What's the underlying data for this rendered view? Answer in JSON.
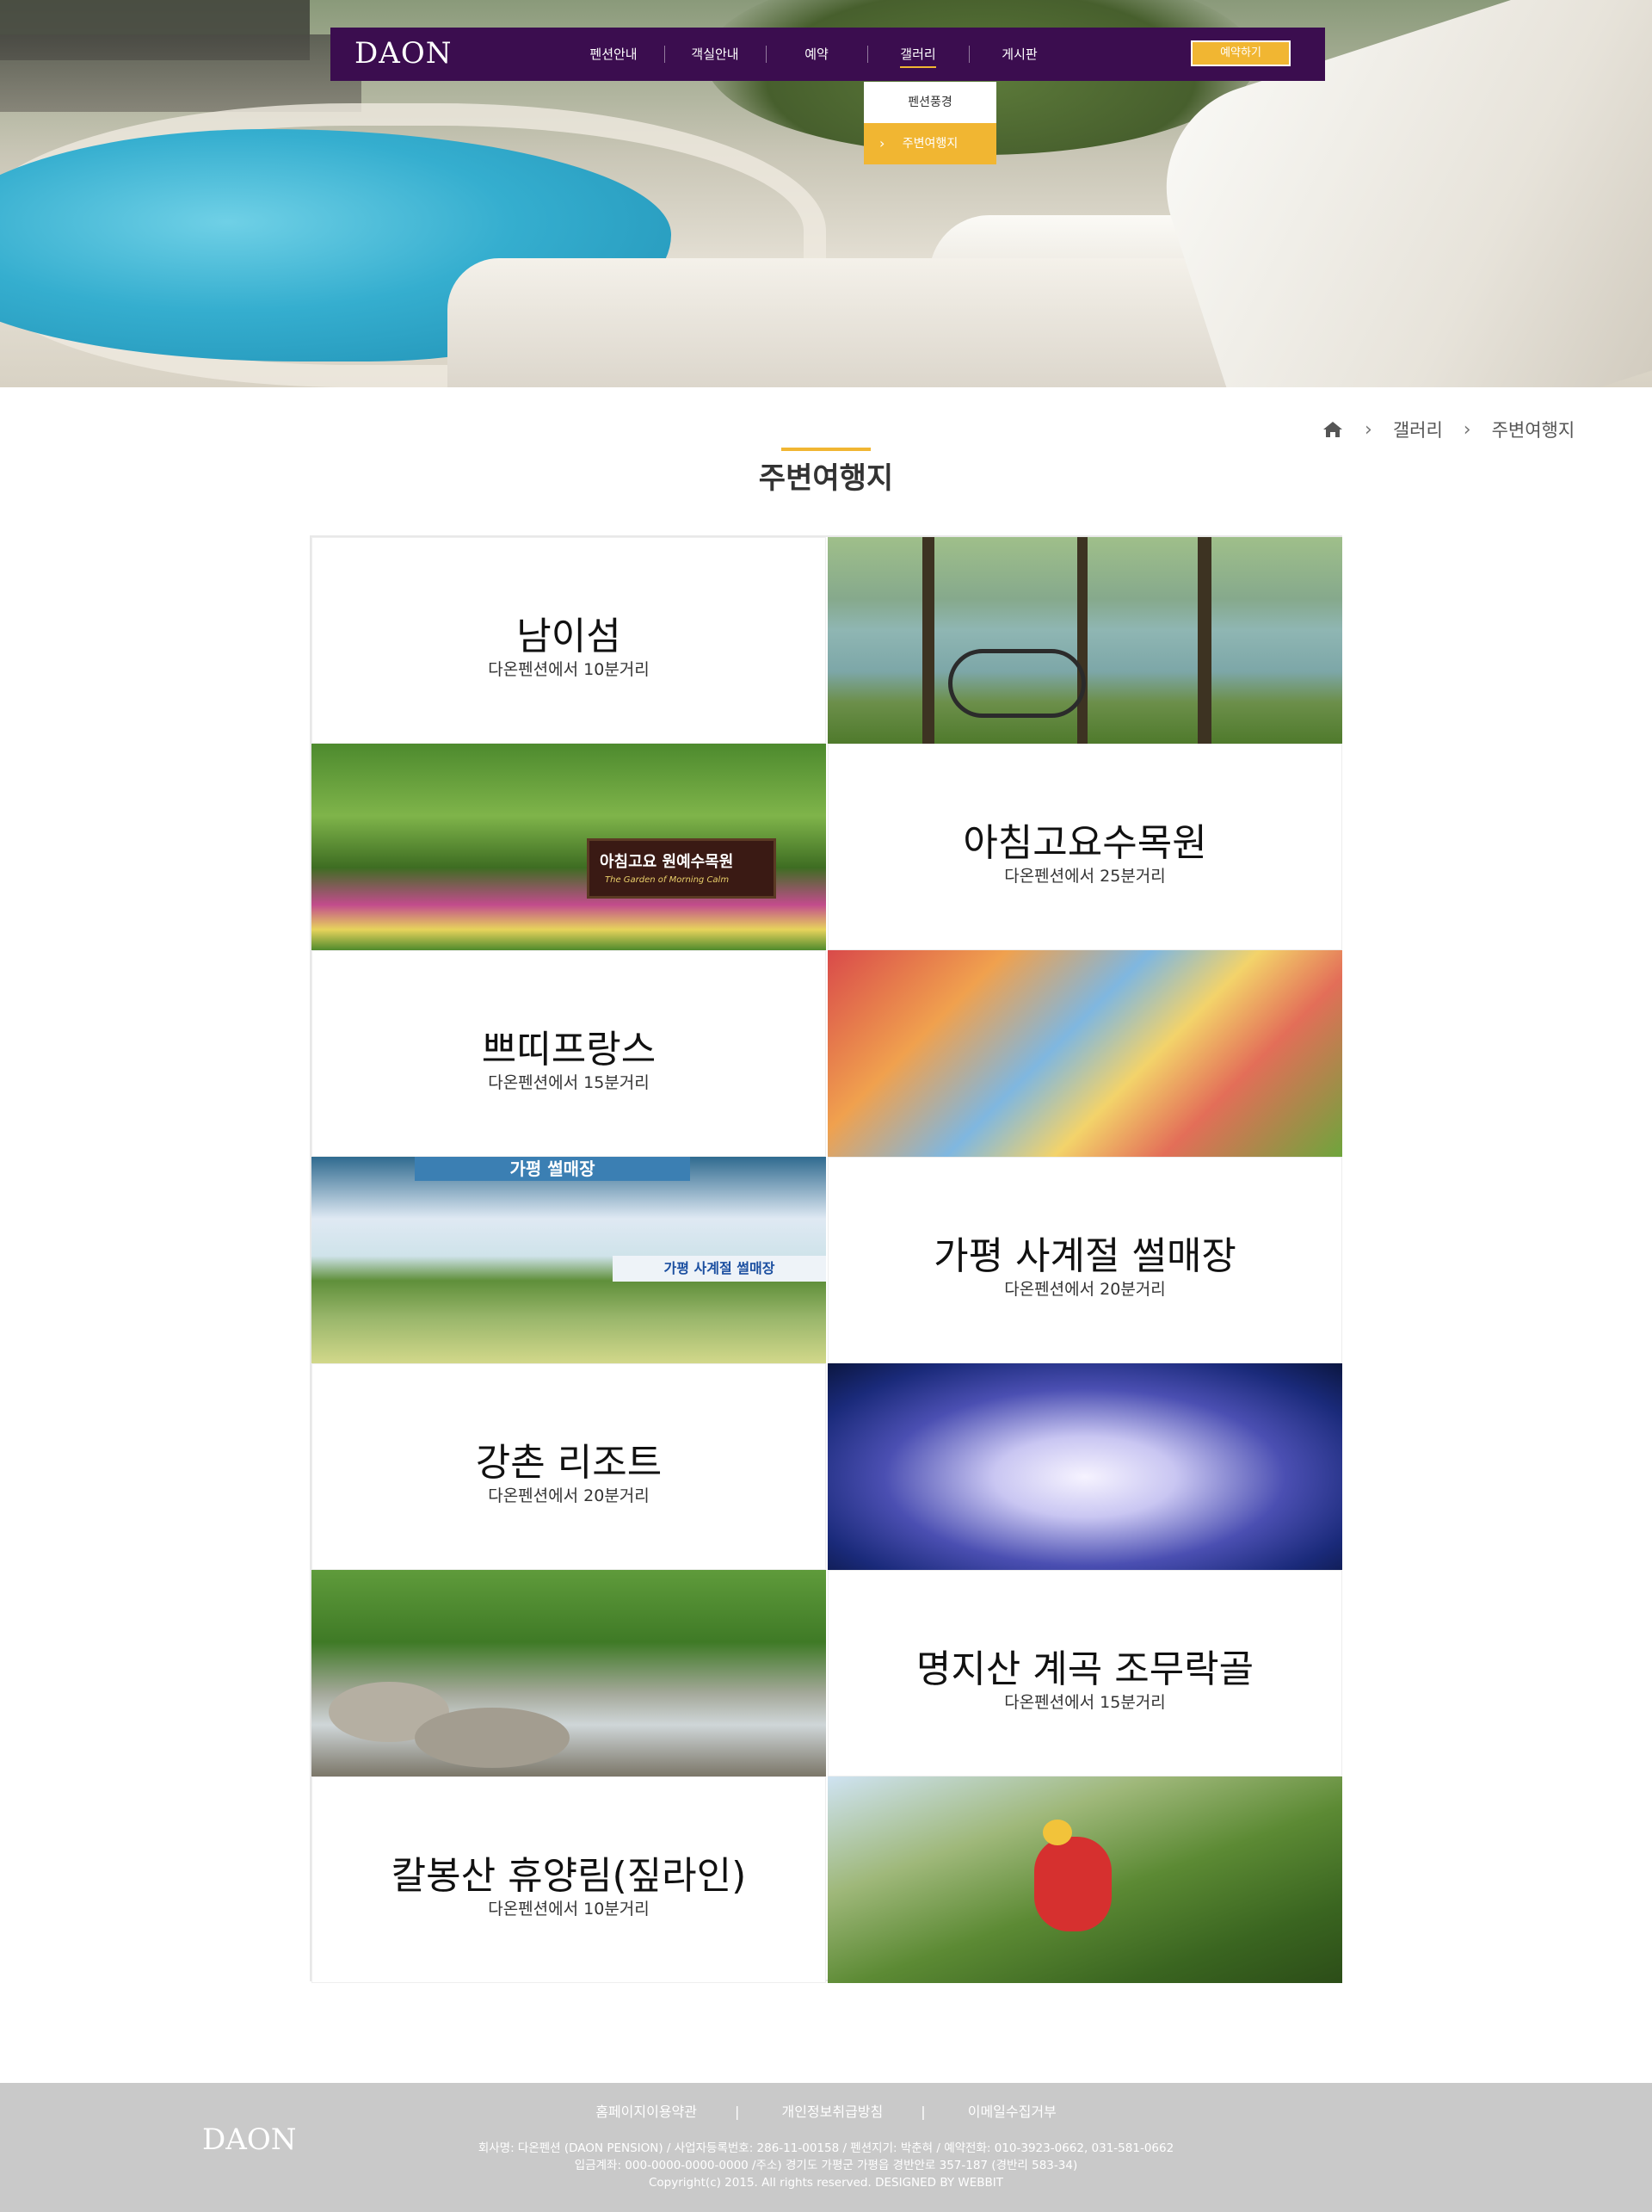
{
  "header": {
    "logo": "DAON",
    "menu": [
      "펜션안내",
      "객실안내",
      "예약",
      "갤러리",
      "게시판"
    ],
    "active_menu": "갤러리",
    "reserve_button": "예약하기",
    "submenu": [
      "펜션풍경",
      "주변여행지"
    ],
    "submenu_selected": "주변여행지"
  },
  "breadcrumb": [
    "갤러리",
    "주변여행지"
  ],
  "page_title": "주변여행지",
  "places": [
    {
      "name": "남이섬",
      "distance": "다온펜션에서 10분거리"
    },
    {
      "name": "아침고요수목원",
      "distance": "다온펜션에서 25분거리"
    },
    {
      "name": "쁘띠프랑스",
      "distance": "다온펜션에서 15분거리"
    },
    {
      "name": "가평 사계절 썰매장",
      "distance": "다온펜션에서 20분거리"
    },
    {
      "name": "강촌 리조트",
      "distance": "다온펜션에서 20분거리"
    },
    {
      "name": "명지산 계곡 조무락골",
      "distance": "다온펜션에서 15분거리"
    },
    {
      "name": "칼봉산 휴양림(짚라인)",
      "distance": "다온펜션에서 10분거리"
    }
  ],
  "photo_labels": {
    "garden_sign": "아침고요 원예수목원",
    "garden_sub": "The Garden of Morning Calm",
    "sled_banner_top": "가평 썰매장",
    "sled_banner": "가평 사계절 썰매장"
  },
  "footer": {
    "links": [
      "홈페이지이용약관",
      "개인정보취급방침",
      "이메일수집거부"
    ],
    "logo": "DAON",
    "info_line1": "회사명: 다온펜션 (DAON PENSION) / 사업자등록번호: 286-11-00158 / 펜션지기: 박춘혀 / 예약전화: 010-3923-0662, 031-581-0662",
    "info_line2": "입금계좌: 000-0000-0000-0000 /주소) 경기도 가평군 가평읍 경반안로 357-187 (경반리 583-34)",
    "copyright": "Copyright(c) 2015. All rights reserved. DESIGNED BY WEBBIT"
  },
  "colors": {
    "nav_bg": "#3b0d4f",
    "accent": "#f1b632",
    "footer_bg": "#c9c9c9"
  }
}
